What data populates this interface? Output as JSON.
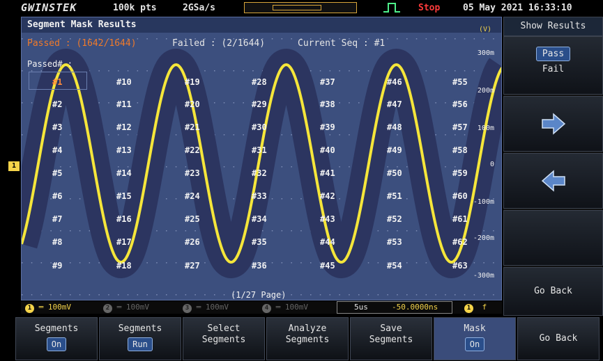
{
  "status": {
    "logo": "GWINSTEK",
    "points": "100k pts",
    "sample_rate": "2GSa/s",
    "state": "Stop",
    "datetime": "05 May 2021 16:33:10"
  },
  "screen": {
    "title": "Segment Mask Results",
    "unit": "(V)",
    "passed": "Passed : (1642/1644)",
    "failed": "Failed : (2/1644)",
    "current_seq": "Current Seq : #1",
    "passed_header": "Passed# :",
    "page": "(1/27 Page)",
    "segments": [
      [
        "#1",
        "#2",
        "#3",
        "#4",
        "#5",
        "#6",
        "#7",
        "#8",
        "#9"
      ],
      [
        "#10",
        "#11",
        "#12",
        "#13",
        "#14",
        "#15",
        "#16",
        "#17",
        "#18"
      ],
      [
        "#19",
        "#20",
        "#21",
        "#22",
        "#23",
        "#24",
        "#25",
        "#26",
        "#27"
      ],
      [
        "#28",
        "#29",
        "#30",
        "#31",
        "#32",
        "#33",
        "#34",
        "#35",
        "#36"
      ],
      [
        "#37",
        "#38",
        "#39",
        "#40",
        "#41",
        "#42",
        "#43",
        "#44",
        "#45"
      ],
      [
        "#46",
        "#47",
        "#48",
        "#49",
        "#50",
        "#51",
        "#52",
        "#53",
        "#54"
      ],
      [
        "#55",
        "#56",
        "#57",
        "#58",
        "#59",
        "#60",
        "#61",
        "#62",
        "#63"
      ]
    ],
    "vscale": [
      "300m",
      "200m",
      "100m",
      "0",
      "-100m",
      "-200m",
      "-300m"
    ],
    "channel_marker": "1"
  },
  "infobar": {
    "ch1": "100mV",
    "ch2": "100mV",
    "ch3": "100mV",
    "ch4": "100mV",
    "timebase": "5us",
    "position": "-50.0000ns",
    "trig_slope": "f"
  },
  "rightmenu": {
    "title": "Show Results",
    "pass": "Pass",
    "fail": "Fail",
    "go_back": "Go Back"
  },
  "bottom": [
    {
      "label1": "Segments",
      "label2": "",
      "chip": "On"
    },
    {
      "label1": "Segments",
      "label2": "",
      "chip": "Run"
    },
    {
      "label1": "Select",
      "label2": "Segments",
      "chip": ""
    },
    {
      "label1": "Analyze",
      "label2": "Segments",
      "chip": ""
    },
    {
      "label1": "Save",
      "label2": "Segments",
      "chip": ""
    },
    {
      "label1": "Mask",
      "label2": "",
      "chip": "On"
    },
    {
      "label1": "Go Back",
      "label2": "",
      "chip": ""
    }
  ],
  "colors": {
    "grid_bg": "#3c4f7e",
    "trace": "#f5e63a",
    "mask": "#2c3560",
    "passed": "#f07a2a",
    "stop": "#ff3b3b"
  }
}
